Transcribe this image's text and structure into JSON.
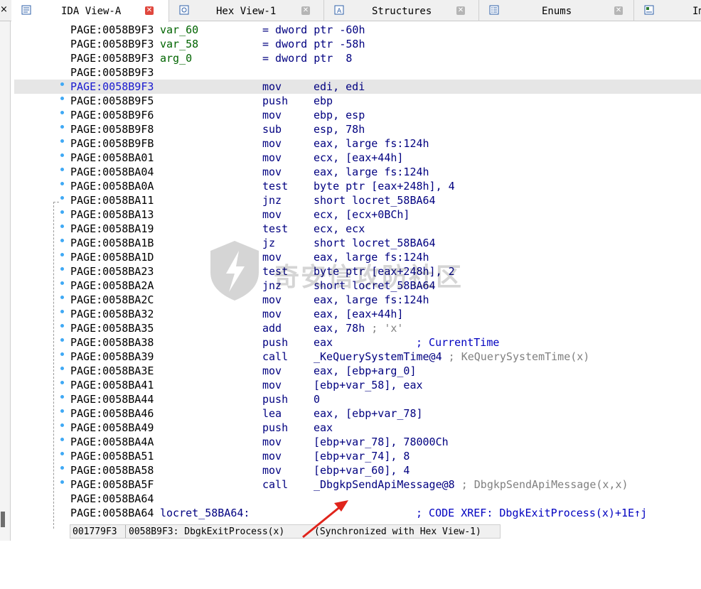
{
  "tabs": [
    {
      "label": "IDA View-A",
      "icon": "listing-view-icon",
      "active": true
    },
    {
      "label": "Hex View-1",
      "icon": "hex-view-icon",
      "active": false
    },
    {
      "label": "Structures",
      "icon": "structures-icon",
      "active": false
    },
    {
      "label": "Enums",
      "icon": "enums-icon",
      "active": false
    },
    {
      "label": "Im",
      "icon": "imports-icon",
      "active": false
    }
  ],
  "left_close": "×",
  "lines": [
    {
      "addr": "PAGE:0058B9F3",
      "label": "var_60",
      "def": "= dword ptr -60h"
    },
    {
      "addr": "PAGE:0058B9F3",
      "label": "var_58",
      "def": "= dword ptr -58h"
    },
    {
      "addr": "PAGE:0058B9F3",
      "label": "arg_0",
      "def": "= dword ptr  8"
    },
    {
      "addr": "PAGE:0058B9F3"
    },
    {
      "addr": "PAGE:0058B9F3",
      "mn": "mov",
      "ops": "edi, edi",
      "dot": true,
      "selected": true
    },
    {
      "addr": "PAGE:0058B9F5",
      "mn": "push",
      "ops": "ebp",
      "dot": true
    },
    {
      "addr": "PAGE:0058B9F6",
      "mn": "mov",
      "ops": "ebp, esp",
      "dot": true
    },
    {
      "addr": "PAGE:0058B9F8",
      "mn": "sub",
      "ops": "esp, 78h",
      "dot": true
    },
    {
      "addr": "PAGE:0058B9FB",
      "mn": "mov",
      "ops": "eax, large fs:124h",
      "dot": true
    },
    {
      "addr": "PAGE:0058BA01",
      "mn": "mov",
      "ops": "ecx, [eax+44h]",
      "dot": true
    },
    {
      "addr": "PAGE:0058BA04",
      "mn": "mov",
      "ops": "eax, large fs:124h",
      "dot": true
    },
    {
      "addr": "PAGE:0058BA0A",
      "mn": "test",
      "ops": "byte ptr [eax+248h], 4",
      "dot": true
    },
    {
      "addr": "PAGE:0058BA11",
      "mn": "jnz",
      "ops": "short locret_58BA64",
      "dot": true
    },
    {
      "addr": "PAGE:0058BA13",
      "mn": "mov",
      "ops": "ecx, [ecx+0BCh]",
      "dot": true
    },
    {
      "addr": "PAGE:0058BA19",
      "mn": "test",
      "ops": "ecx, ecx",
      "dot": true
    },
    {
      "addr": "PAGE:0058BA1B",
      "mn": "jz",
      "ops": "short locret_58BA64",
      "dot": true
    },
    {
      "addr": "PAGE:0058BA1D",
      "mn": "mov",
      "ops": "eax, large fs:124h",
      "dot": true
    },
    {
      "addr": "PAGE:0058BA23",
      "mn": "test",
      "ops": "byte ptr [eax+248h], 2",
      "dot": true
    },
    {
      "addr": "PAGE:0058BA2A",
      "mn": "jnz",
      "ops": "short locret_58BA64",
      "dot": true
    },
    {
      "addr": "PAGE:0058BA2C",
      "mn": "mov",
      "ops": "eax, large fs:124h",
      "dot": true
    },
    {
      "addr": "PAGE:0058BA32",
      "mn": "mov",
      "ops": "eax, [eax+44h]",
      "dot": true
    },
    {
      "addr": "PAGE:0058BA35",
      "mn": "add",
      "ops": "eax, 78h",
      "comment": " ; 'x'",
      "dot": true
    },
    {
      "addr": "PAGE:0058BA38",
      "mn": "push",
      "ops": "eax",
      "comment2": "; CurrentTime",
      "dot": true
    },
    {
      "addr": "PAGE:0058BA39",
      "mn": "call",
      "ops": "_KeQuerySystemTime@4",
      "comment": " ; KeQuerySystemTime(x)",
      "dot": true
    },
    {
      "addr": "PAGE:0058BA3E",
      "mn": "mov",
      "ops": "eax, [ebp+arg_0]",
      "dot": true
    },
    {
      "addr": "PAGE:0058BA41",
      "mn": "mov",
      "ops": "[ebp+var_58], eax",
      "dot": true
    },
    {
      "addr": "PAGE:0058BA44",
      "mn": "push",
      "ops": "0",
      "dot": true
    },
    {
      "addr": "PAGE:0058BA46",
      "mn": "lea",
      "ops": "eax, [ebp+var_78]",
      "dot": true
    },
    {
      "addr": "PAGE:0058BA49",
      "mn": "push",
      "ops": "eax",
      "dot": true
    },
    {
      "addr": "PAGE:0058BA4A",
      "mn": "mov",
      "ops": "[ebp+var_78], 78000Ch",
      "dot": true
    },
    {
      "addr": "PAGE:0058BA51",
      "mn": "mov",
      "ops": "[ebp+var_74], 8",
      "dot": true
    },
    {
      "addr": "PAGE:0058BA58",
      "mn": "mov",
      "ops": "[ebp+var_60], 4",
      "dot": true
    },
    {
      "addr": "PAGE:0058BA5F",
      "mn": "call",
      "ops": "_DbgkpSendApiMessage@8",
      "comment": " ; DbgkpSendApiMessage(x,x)",
      "dot": true
    },
    {
      "addr": "PAGE:0058BA64"
    },
    {
      "addr": "PAGE:0058BA64",
      "loc": "locret_58BA64:",
      "xref": "; CODE XREF: DbgkExitProcess(x)+1E↑j"
    }
  ],
  "status": {
    "offset": "001779F3",
    "location": "0058B9F3: DbgkExitProcess(x)",
    "sync": "(Synchronized with Hex View-1)"
  },
  "watermark": "奇安信攻防社区",
  "colors": {
    "accent": "#e0483e",
    "selection": "#e6e6e6",
    "dot": "#3fa9f5",
    "arrow": "#e0241b"
  }
}
